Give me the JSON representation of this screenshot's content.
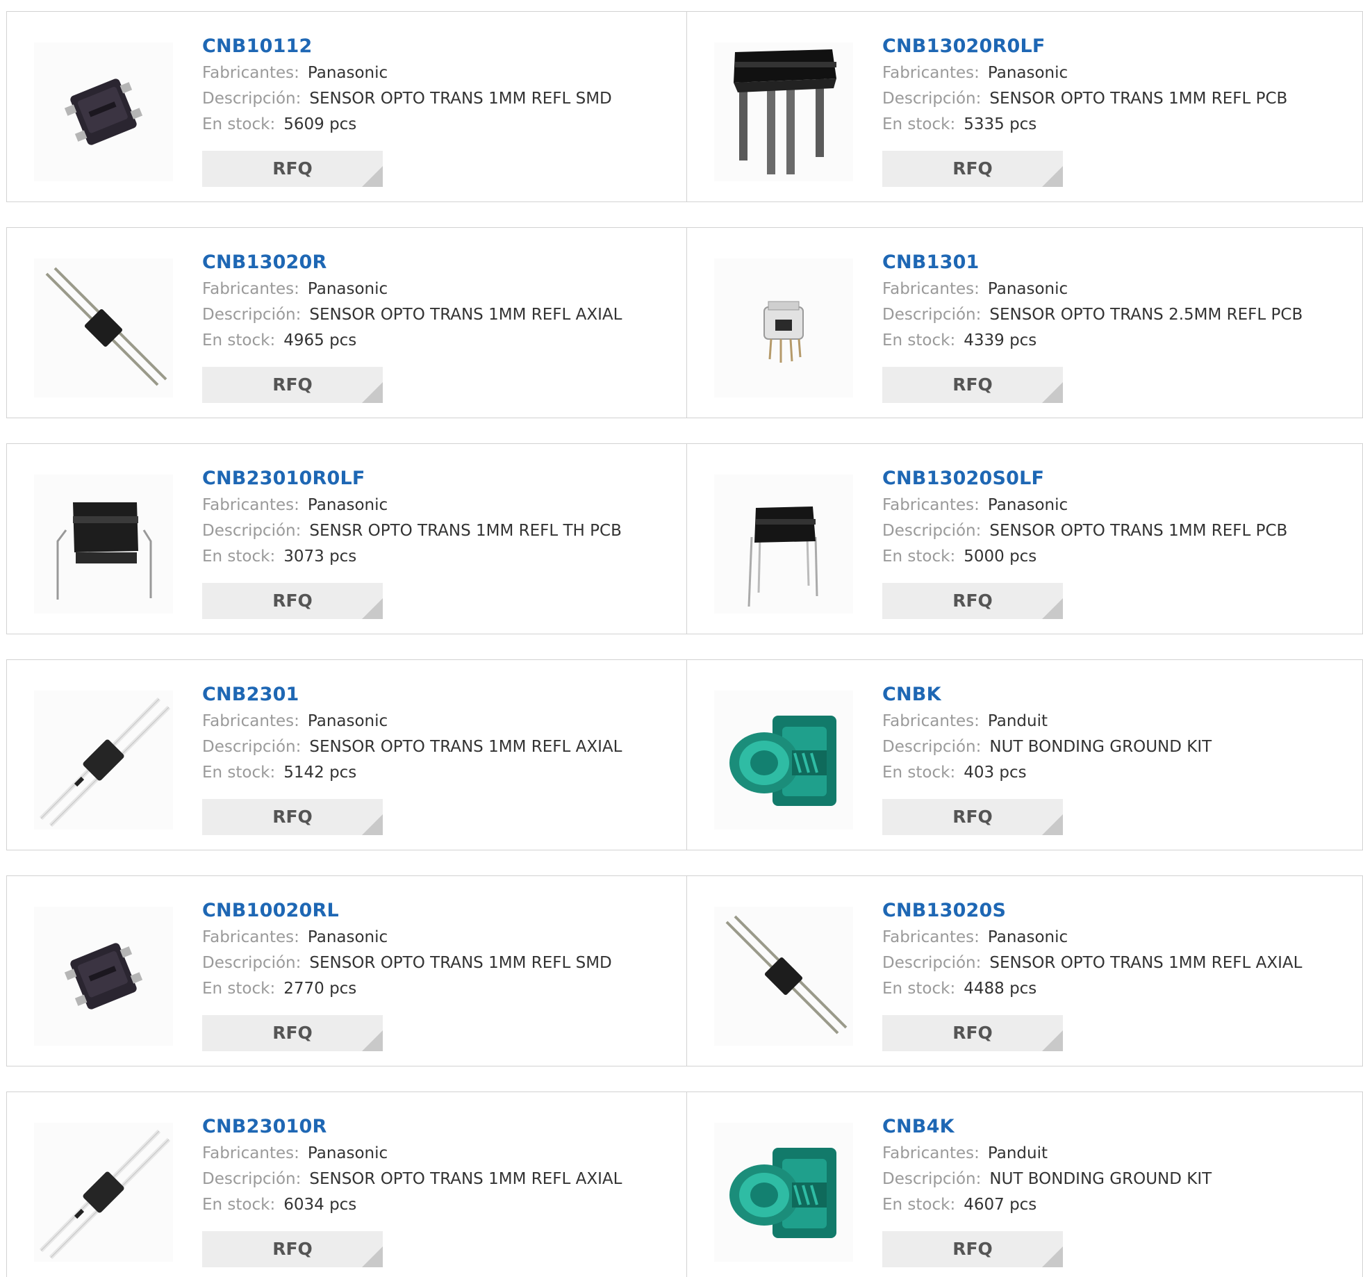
{
  "labels": {
    "manufacturer": "Fabricantes:",
    "description": "Descripción:",
    "stock": "En stock:",
    "rfq": "RFQ"
  },
  "products": [
    {
      "part": "CNB10112",
      "manufacturer": "Panasonic",
      "description": "SENSOR OPTO TRANS 1MM REFL SMD",
      "stock": "5609 pcs",
      "image": "smd-chip-icon"
    },
    {
      "part": "CNB13020R0LF",
      "manufacturer": "Panasonic",
      "description": "SENSOR OPTO TRANS 1MM REFL PCB",
      "stock": "5335 pcs",
      "image": "pcb-sensor-tall-icon"
    },
    {
      "part": "CNB13020R",
      "manufacturer": "Panasonic",
      "description": "SENSOR OPTO TRANS 1MM REFL AXIAL",
      "stock": "4965 pcs",
      "image": "axial-sensor-icon"
    },
    {
      "part": "CNB1301",
      "manufacturer": "Panasonic",
      "description": "SENSOR OPTO TRANS 2.5MM REFL PCB",
      "stock": "4339 pcs",
      "image": "clear-sensor-icon"
    },
    {
      "part": "CNB23010R0LF",
      "manufacturer": "Panasonic",
      "description": "SENSR OPTO TRANS 1MM REFL TH PCB",
      "stock": "3073 pcs",
      "image": "th-pcb-sensor-icon"
    },
    {
      "part": "CNB13020S0LF",
      "manufacturer": "Panasonic",
      "description": "SENSOR OPTO TRANS 1MM REFL PCB",
      "stock": "5000 pcs",
      "image": "pcb-sensor-icon"
    },
    {
      "part": "CNB2301",
      "manufacturer": "Panasonic",
      "description": "SENSOR OPTO TRANS 1MM REFL AXIAL",
      "stock": "5142 pcs",
      "image": "axial-white-lead-sensor-icon"
    },
    {
      "part": "CNBK",
      "manufacturer": "Panduit",
      "description": "NUT BONDING GROUND KIT",
      "stock": "403 pcs",
      "image": "green-nut-bolt-icon"
    },
    {
      "part": "CNB10020RL",
      "manufacturer": "Panasonic",
      "description": "SENSOR OPTO TRANS 1MM REFL SMD",
      "stock": "2770 pcs",
      "image": "smd-chip-icon"
    },
    {
      "part": "CNB13020S",
      "manufacturer": "Panasonic",
      "description": "SENSOR OPTO TRANS 1MM REFL AXIAL",
      "stock": "4488 pcs",
      "image": "axial-sensor-icon"
    },
    {
      "part": "CNB23010R",
      "manufacturer": "Panasonic",
      "description": "SENSOR OPTO TRANS 1MM REFL AXIAL",
      "stock": "6034 pcs",
      "image": "axial-white-lead-sensor-icon"
    },
    {
      "part": "CNB4K",
      "manufacturer": "Panduit",
      "description": "NUT BONDING GROUND KIT",
      "stock": "4607 pcs",
      "image": "green-nut-bolt-icon"
    }
  ],
  "colors": {
    "link": "#1e67b4",
    "label": "#9a9a9a",
    "border": "#d2d2d2",
    "button_bg": "#ededed"
  }
}
